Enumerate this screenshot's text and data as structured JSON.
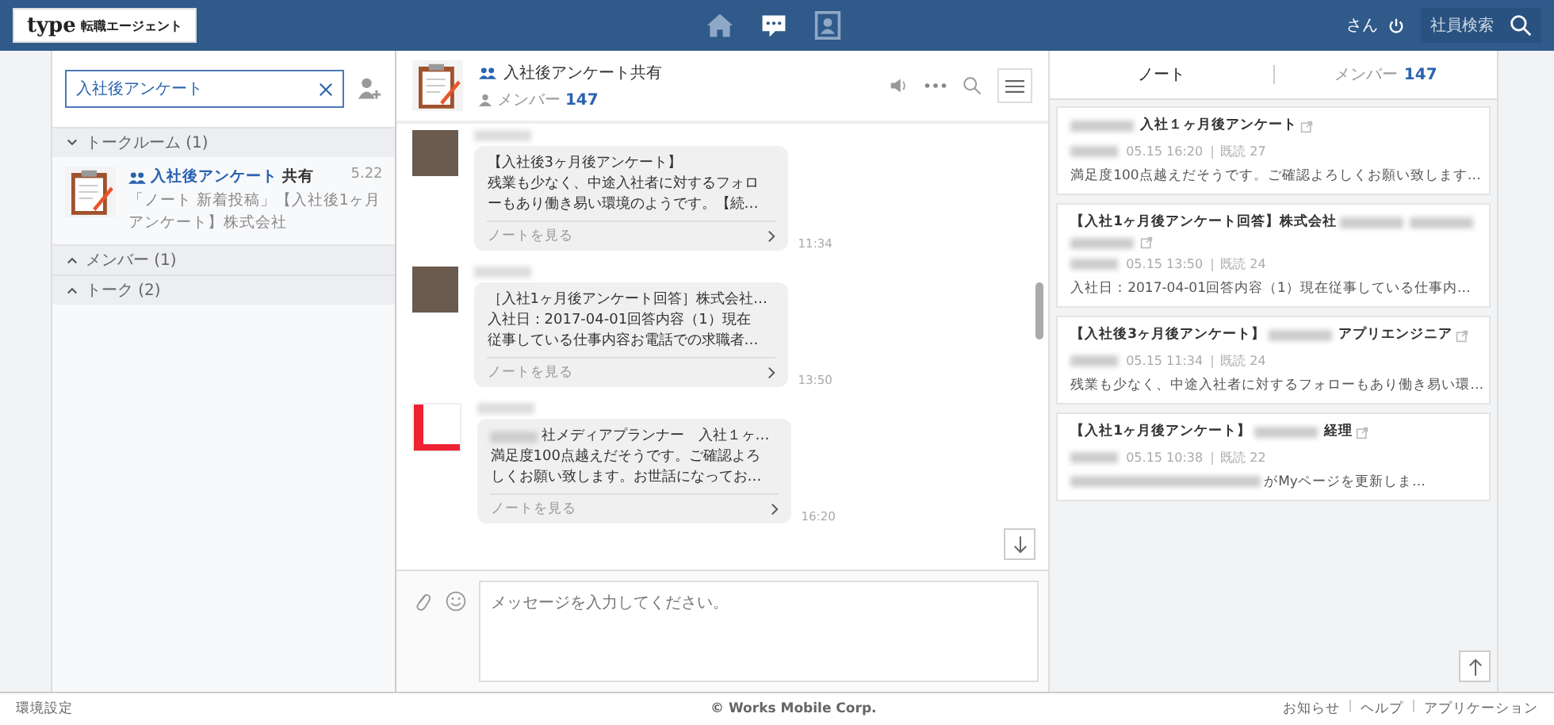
{
  "header": {
    "logo": {
      "brand": "type",
      "sub": "転職エージェント"
    },
    "nav": [
      {
        "kind": "home",
        "selected": false
      },
      {
        "kind": "chat",
        "selected": true
      },
      {
        "kind": "contacts",
        "selected": false
      }
    ],
    "user_suffix": "さん",
    "employee_search": "社員検索"
  },
  "sidebar": {
    "search": {
      "value": "入社後アンケート"
    },
    "sections": [
      {
        "label": "トークルーム (1)",
        "expanded": true,
        "items": [
          {
            "name_match": "入社後アンケート",
            "name_rest": "共有",
            "date": "5.22",
            "preview": "「ノート 新着投稿」【入社後1ヶ月アンケート】株式会社"
          }
        ]
      },
      {
        "label": "メンバー (1)",
        "expanded": false
      },
      {
        "label": "トーク (2)",
        "expanded": false
      }
    ]
  },
  "chat": {
    "title": "入社後アンケート共有",
    "member_label": "メンバー",
    "member_count": "147",
    "messages": [
      {
        "kind": "photo",
        "lines": [
          {
            "kind": "text",
            "text": "【入社後3ヶ月後アンケート】"
          },
          {
            "kind": "text",
            "text": "残業も少なく、中途入社者に対するフォロ"
          },
          {
            "kind": "text",
            "text": "ーもあり働き易い環境のようです。【続…"
          }
        ],
        "link": "ノートを見る",
        "time": "11:34"
      },
      {
        "kind": "photo",
        "lines": [
          {
            "kind": "text",
            "text": "［入社1ヶ月後アンケート回答］株式会社…"
          },
          {
            "kind": "text",
            "text": "入社日：2017-04-01回答内容（1）現在"
          },
          {
            "kind": "text",
            "text": "従事している仕事内容お電話での求職者…"
          }
        ],
        "link": "ノートを見る",
        "time": "13:50"
      },
      {
        "kind": "illustration",
        "lines": [
          {
            "kind": "redacted_prefix",
            "text": "社メディアプランナー　入社１ヶ…"
          },
          {
            "kind": "text",
            "text": "満足度100点越えだそうです。ご確認よろ"
          },
          {
            "kind": "text",
            "text": "しくお願い致します。お世話になってお…"
          }
        ],
        "link": "ノートを見る",
        "time": "16:20"
      }
    ],
    "input": {
      "placeholder": "メッセージを入力してください。"
    }
  },
  "panel": {
    "tabs": [
      {
        "label": "ノート",
        "selected": true
      },
      {
        "label": "メンバー",
        "count": "147",
        "selected": false
      }
    ],
    "notes": [
      {
        "title_parts": [
          {
            "kind": "redacted"
          },
          {
            "kind": "text",
            "text": "入社１ヶ月後アンケート"
          }
        ],
        "time": "05.15 16:20",
        "read": "既読 27",
        "body": "満足度100点越えだそうです。ご確認よろしくお願い致します…"
      },
      {
        "title_parts": [
          {
            "kind": "text",
            "text": "【入社1ヶ月後アンケート回答】株式会社"
          },
          {
            "kind": "redacted"
          },
          {
            "kind": "redacted"
          },
          {
            "kind": "redacted"
          }
        ],
        "time": "05.15 13:50",
        "read": "既読 24",
        "body": "入社日：2017-04-01回答内容（1）現在従事している仕事内…"
      },
      {
        "title_parts": [
          {
            "kind": "text",
            "text": "【入社後3ヶ月後アンケート】"
          },
          {
            "kind": "redacted"
          },
          {
            "kind": "text",
            "text": "アプリエンジニア"
          }
        ],
        "time": "05.15 11:34",
        "read": "既読 24",
        "body": "残業も少なく、中途入社者に対するフォローもあり働き易い環…"
      },
      {
        "title_parts": [
          {
            "kind": "text",
            "text": "【入社1ヶ月後アンケート】"
          },
          {
            "kind": "redacted"
          },
          {
            "kind": "text",
            "text": "経理"
          }
        ],
        "time": "05.15 10:38",
        "read": "既読 22",
        "body": "がMyページを更新しま…"
      }
    ]
  },
  "footer": {
    "settings": "環境設定",
    "copyright": "© Works Mobile Corp.",
    "links": [
      "お知らせ",
      "ヘルプ",
      "アプリケーション"
    ]
  }
}
